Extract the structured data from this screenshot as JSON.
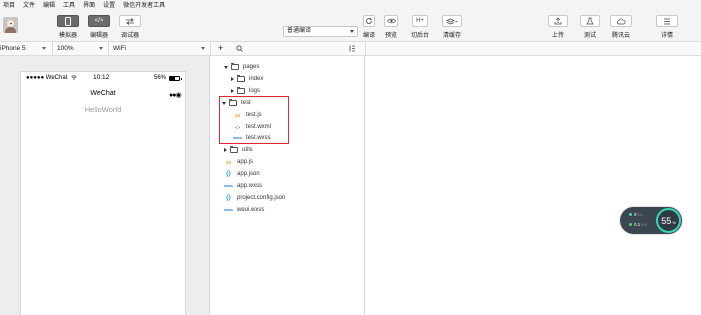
{
  "menu": [
    "项目",
    "文件",
    "编辑",
    "工具",
    "界面",
    "设置",
    "微信开发者工具"
  ],
  "toolbar": {
    "simulator_label": "模拟器",
    "editor_label": "编辑器",
    "debugger_label": "调试器",
    "editor_icon_text": "</>",
    "compile_mode": "普通编译",
    "compile_label": "编译",
    "preview_label": "预览",
    "backend_icon_text": "H+",
    "backend_label": "切后台",
    "clear_cache_label": "清缓存",
    "upload_label": "上传",
    "test_label": "测试",
    "cloud_label": "腾讯云",
    "details_label": "详情"
  },
  "subbar": {
    "device": "iPhone 5",
    "zoom": "100%",
    "network": "WiFi",
    "add_symbol": "+"
  },
  "simulator": {
    "carrier": "●●●●● WeChat",
    "time": "10:12",
    "battery_text": "56%",
    "battery_level": 0.56,
    "nav_title": "WeChat",
    "nav_menu": "●●◉",
    "content_text": "HelloWorld"
  },
  "file_tree": {
    "pages": "pages",
    "index": "index",
    "logs": "logs",
    "test": "test",
    "test_js": "test.js",
    "test_wxml": "test.wxml",
    "test_wxss": "test.wxss",
    "utils": "utils",
    "app_js": "app.js",
    "app_json": "app.json",
    "app_wxss": "app.wxss",
    "project_config": "project.config.json",
    "weui_wxss": "weui.wxss"
  },
  "file_icons": {
    "js": "JS",
    "wxml": "<>",
    "wxss": "wxss",
    "json": "{}"
  },
  "perf": {
    "upload_value": "0",
    "upload_unit": "K/s",
    "download_value": "0.1",
    "download_unit": "K/s",
    "percent": "55",
    "percent_unit": "%"
  },
  "colors": {
    "highlight_border": "#e0282e",
    "perf_ring": "#36d7b7",
    "upload_dot": "#36d7b7",
    "download_dot": "#4cd964"
  }
}
